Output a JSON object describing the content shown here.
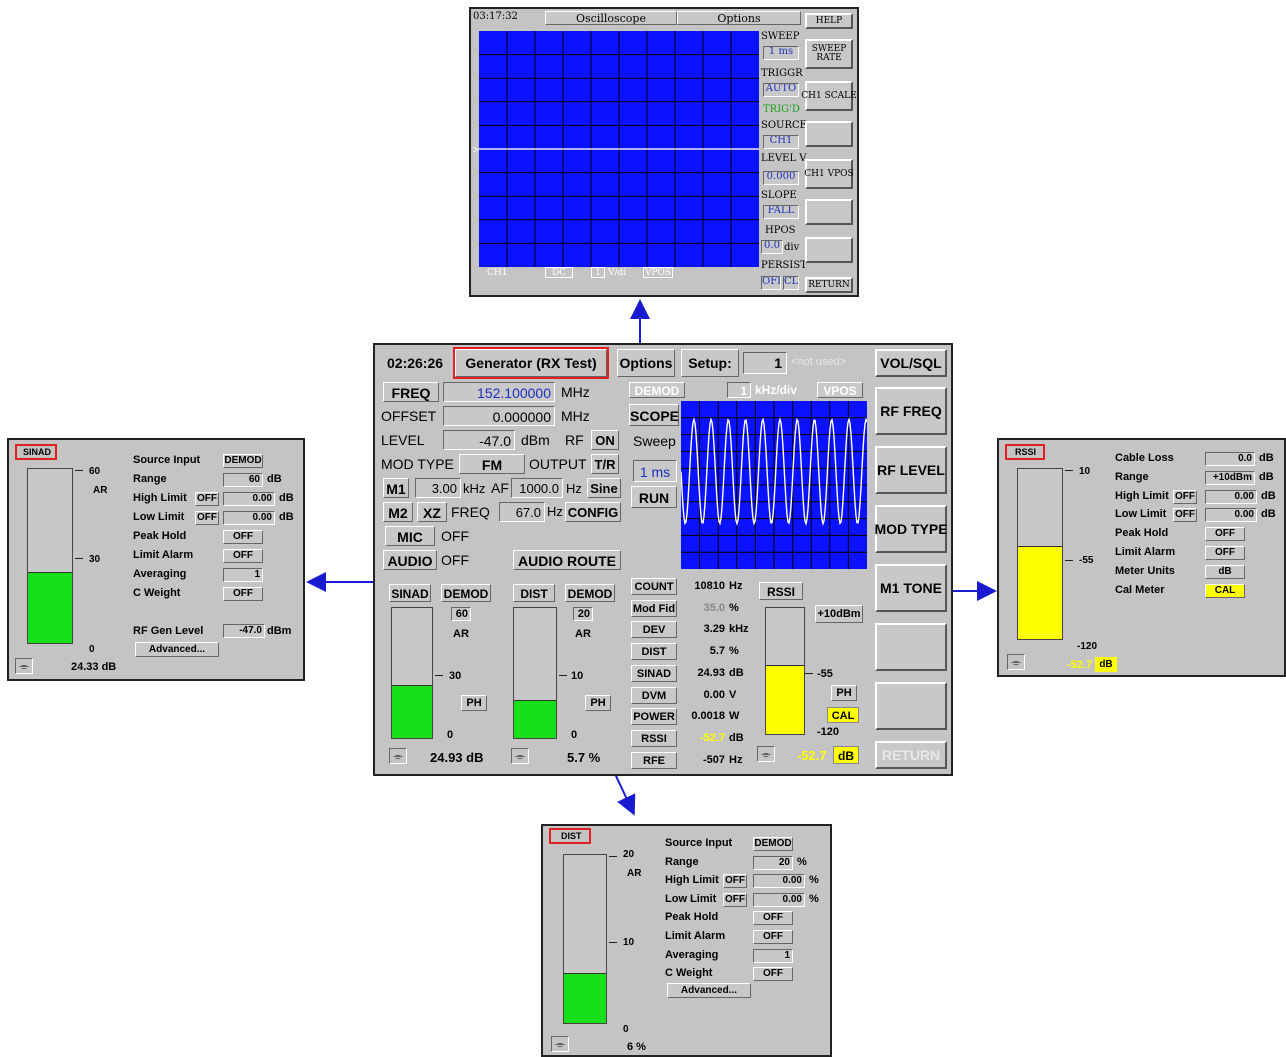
{
  "colors": {
    "scope_bg": "#0a12ff",
    "bar_green": "#18e018",
    "bar_yellow": "#ffff00",
    "highlight": "#ffff00",
    "field_blue": "#1a2fbf",
    "arrow": "#1a1ad0",
    "callout": "#e02020"
  },
  "osc": {
    "time": "03:17:32",
    "title": "Oscilloscope",
    "options": "Options",
    "footer_ch": "CH1",
    "footer_dc": "DC",
    "footer_scale_val": "1",
    "footer_scale_unit": "V/di",
    "footer_vpos": "VPOS",
    "side": [
      {
        "label": "SWEEP",
        "value": "1 ms"
      },
      {
        "label": "TRIGGR",
        "value": "AUTO",
        "value2": "TRIG'D"
      },
      {
        "label": "SOURCE",
        "value": "CH1"
      },
      {
        "label": "LEVEL V",
        "value": "0.000"
      },
      {
        "label": "SLOPE",
        "value": "FALL"
      },
      {
        "label": "HPOS",
        "value": "0.0",
        "unit": "div"
      },
      {
        "label": "PERSIST",
        "value": "OFF",
        "value2": "CL"
      }
    ],
    "buttons": [
      "HELP",
      "SWEEP RATE",
      "CH1 SCALE",
      "",
      "CH1 VPOS",
      "",
      "",
      "RETURN"
    ]
  },
  "main": {
    "time": "02:26:26",
    "title": "Generator (RX Test)",
    "options": "Options",
    "setup_label": "Setup:",
    "setup_value": "1",
    "setup_note": "<not used>",
    "freq_label": "FREQ",
    "freq_value": "152.100000",
    "freq_unit": "MHz",
    "offset_label": "OFFSET",
    "offset_value": "0.000000",
    "offset_unit": "MHz",
    "level_label": "LEVEL",
    "level_value": "-47.0",
    "level_unit": "dBm",
    "rf_label": "RF",
    "rf_value": "ON",
    "modtype_label": "MOD TYPE",
    "modtype_value": "FM",
    "output_label": "OUTPUT",
    "output_value": "T/R",
    "m1_label": "M1",
    "m1_value": "3.00",
    "m1_unit": "kHz",
    "af_label": "AF",
    "af_value": "1000.0",
    "af_unit": "Hz",
    "wave": "Sine",
    "m2_label": "M2",
    "xz_label": "XZ",
    "m2freq_label": "FREQ",
    "m2_value": "67.0",
    "m2_unit": "Hz",
    "config": "CONFIG",
    "mic_label": "MIC",
    "mic_value": "OFF",
    "audio_label": "AUDIO",
    "audio_value": "OFF",
    "audio_route": "AUDIO ROUTE",
    "scope": {
      "demod": "DEMOD",
      "scale_val": "1",
      "scale_unit": "kHz/div",
      "vpos": "VPOS",
      "label": "SCOPE",
      "sweep": "Sweep",
      "sweep_val": "1 ms",
      "run": "RUN"
    },
    "sinad": {
      "label": "SINAD",
      "src": "DEMOD",
      "range": "60",
      "ar": "AR",
      "mid": "30",
      "zero": "0",
      "ph": "PH",
      "reading": "24.93 dB",
      "fill": 0.41
    },
    "dist": {
      "label": "DIST",
      "src": "DEMOD",
      "range": "20",
      "ar": "AR",
      "mid": "10",
      "zero": "0",
      "ph": "PH",
      "reading": "5.7 %",
      "fill": 0.29
    },
    "meters": [
      {
        "name": "COUNT",
        "value": "10810",
        "unit": "Hz"
      },
      {
        "name": "Mod Fid",
        "value": "35.0",
        "unit": "%"
      },
      {
        "name": "DEV",
        "value": "3.29",
        "unit": "kHz"
      },
      {
        "name": "DIST",
        "value": "5.7",
        "unit": "%"
      },
      {
        "name": "SINAD",
        "value": "24.93",
        "unit": "dB"
      },
      {
        "name": "DVM",
        "value": "0.00",
        "unit": "V"
      },
      {
        "name": "POWER",
        "value": "0.0018",
        "unit": "W"
      },
      {
        "name": "RSSI",
        "value": "-52.7",
        "unit": "dB"
      },
      {
        "name": "RFE",
        "value": "-507",
        "unit": "Hz"
      }
    ],
    "rssi": {
      "label": "RSSI",
      "top": "+10dBm",
      "mid": "-55",
      "bottom": "-120",
      "ph": "PH",
      "cal": "CAL",
      "reading": "-52.7",
      "unit": "dB",
      "fill": 0.55
    },
    "softkeys": [
      "VOL/SQL",
      "RF FREQ",
      "RF LEVEL",
      "MOD TYPE",
      "M1 TONE",
      "",
      "",
      "RETURN"
    ]
  },
  "sinad_pop": {
    "title": "SINAD",
    "top": "60",
    "ar": "AR",
    "mid": "30",
    "zero": "0",
    "reading": "24.33 dB",
    "fill": 0.41,
    "rows": [
      {
        "label": "Source Input",
        "value": "DEMOD"
      },
      {
        "label": "Range",
        "value": "60",
        "unit": "dB"
      },
      {
        "label": "High Limit",
        "off": "OFF",
        "value": "0.00",
        "unit": "dB"
      },
      {
        "label": "Low Limit",
        "off": "OFF",
        "value": "0.00",
        "unit": "dB"
      },
      {
        "label": "Peak Hold",
        "value": "OFF"
      },
      {
        "label": "Limit Alarm",
        "value": "OFF"
      },
      {
        "label": "Averaging",
        "value": "1"
      },
      {
        "label": "C Weight",
        "value": "OFF"
      }
    ],
    "gen_label": "RF Gen Level",
    "gen_value": "-47.0",
    "gen_unit": "dBm",
    "advanced": "Advanced..."
  },
  "dist_pop": {
    "title": "DIST",
    "top": "20",
    "ar": "AR",
    "mid": "10",
    "zero": "0",
    "reading": "6 %",
    "fill": 0.3,
    "rows": [
      {
        "label": "Source Input",
        "value": "DEMOD"
      },
      {
        "label": "Range",
        "value": "20",
        "unit": "%"
      },
      {
        "label": "High Limit",
        "off": "OFF",
        "value": "0.00",
        "unit": "%"
      },
      {
        "label": "Low Limit",
        "off": "OFF",
        "value": "0.00",
        "unit": "%"
      },
      {
        "label": "Peak Hold",
        "value": "OFF"
      },
      {
        "label": "Limit Alarm",
        "value": "OFF"
      },
      {
        "label": "Averaging",
        "value": "1"
      },
      {
        "label": "C Weight",
        "value": "OFF"
      }
    ],
    "advanced": "Advanced..."
  },
  "rssi_pop": {
    "title": "RSSI",
    "top": "10",
    "mid": "-55",
    "bottom": "-120",
    "reading": "-52.7",
    "unit": "dB",
    "fill": 0.55,
    "rows": [
      {
        "label": "Cable Loss",
        "value": "0.0",
        "unit": "dB"
      },
      {
        "label": "Range",
        "value": "+10dBm",
        "unit": "dB"
      },
      {
        "label": "High Limit",
        "off": "OFF",
        "value": "0.00",
        "unit": "dB"
      },
      {
        "label": "Low Limit",
        "off": "OFF",
        "value": "0.00",
        "unit": "dB"
      },
      {
        "label": "Peak Hold",
        "value": "OFF"
      },
      {
        "label": "Limit Alarm",
        "value": "OFF"
      },
      {
        "label": "Meter Units",
        "value": "dB"
      },
      {
        "label": "Cal Meter",
        "value": "CAL",
        "hl": true
      }
    ]
  }
}
